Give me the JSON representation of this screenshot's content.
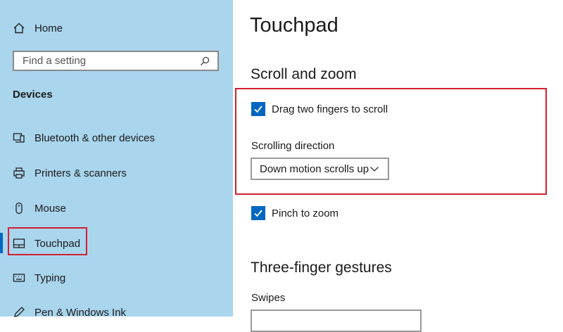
{
  "sidebar": {
    "home_label": "Home",
    "search": {
      "placeholder": "Find a setting"
    },
    "section_title": "Devices",
    "items": [
      {
        "label": "Bluetooth & other devices",
        "icon": "bluetooth-devices-icon"
      },
      {
        "label": "Printers & scanners",
        "icon": "printer-icon"
      },
      {
        "label": "Mouse",
        "icon": "mouse-icon"
      },
      {
        "label": "Touchpad",
        "icon": "touchpad-icon",
        "selected": true
      },
      {
        "label": "Typing",
        "icon": "keyboard-icon"
      },
      {
        "label": "Pen & Windows Ink",
        "icon": "pen-icon"
      }
    ]
  },
  "main": {
    "title": "Touchpad",
    "scroll_zoom": {
      "heading": "Scroll and zoom",
      "drag_two_fingers": {
        "label": "Drag two fingers to scroll",
        "checked": true
      },
      "scrolling_direction": {
        "label": "Scrolling direction",
        "value": "Down motion scrolls up"
      },
      "pinch_to_zoom": {
        "label": "Pinch to zoom",
        "checked": true
      }
    },
    "three_finger": {
      "heading": "Three-finger gestures",
      "swipes_label": "Swipes"
    }
  },
  "colors": {
    "sidebar_bg": "#a9d5ed",
    "accent": "#0067c0",
    "highlight_border": "#d31f2f"
  }
}
